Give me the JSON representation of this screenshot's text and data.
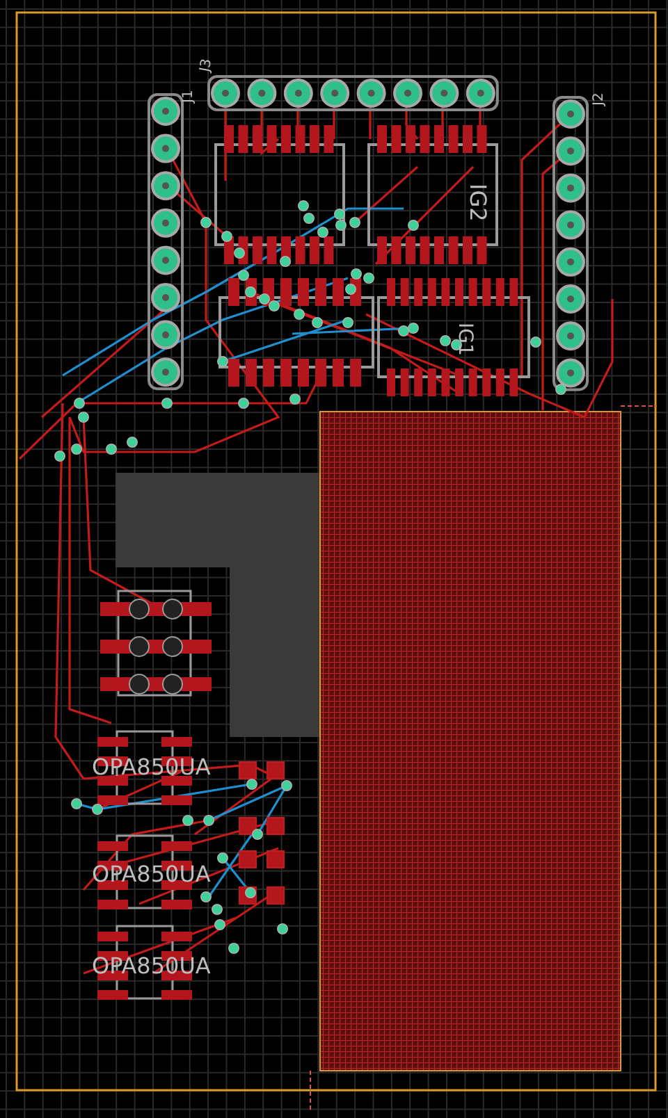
{
  "board": {
    "headers": [
      {
        "label": "J3"
      },
      {
        "label": "J1"
      },
      {
        "label": "J2"
      }
    ],
    "chips": [
      {
        "label": "IG2"
      },
      {
        "label": "IG1"
      }
    ],
    "amplifiers": [
      {
        "label": "OPA850UA"
      },
      {
        "label": "OPA850UA"
      },
      {
        "label": "OPA850UA"
      }
    ]
  }
}
